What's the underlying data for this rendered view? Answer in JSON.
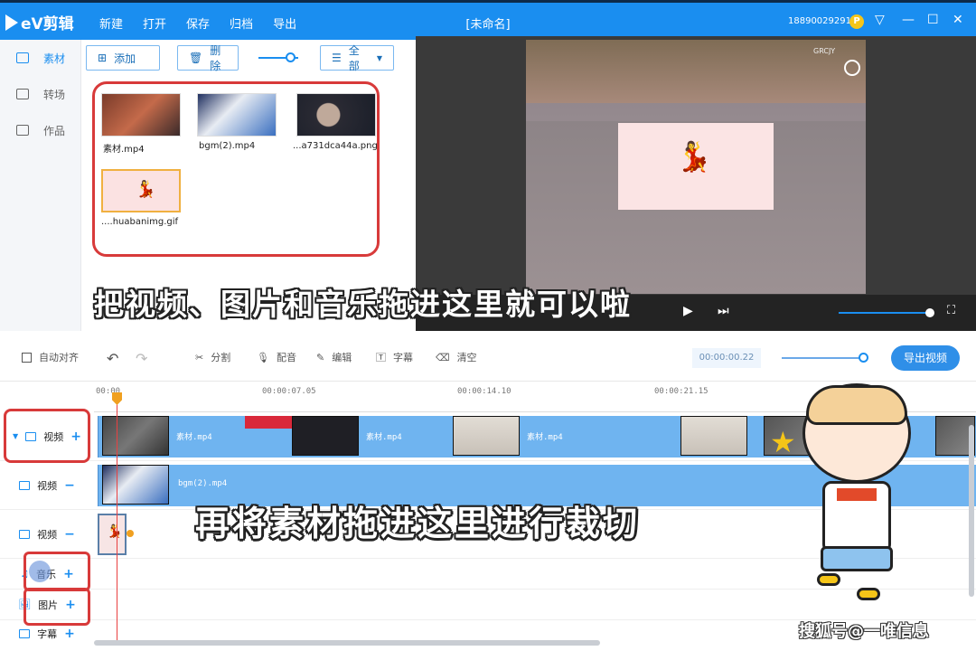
{
  "app": {
    "name": "eV剪辑",
    "window_title": "[未命名]",
    "phone": "18890029291",
    "coin": "P"
  },
  "menu": [
    "新建",
    "打开",
    "保存",
    "归档",
    "导出"
  ],
  "sidebar": {
    "items": [
      {
        "label": "素材",
        "active": true
      },
      {
        "label": "转场"
      },
      {
        "label": "作品"
      }
    ]
  },
  "library": {
    "add_label": "添加",
    "delete_label": "删除",
    "filter_label": "全部",
    "items": [
      {
        "name": "素材.mp4"
      },
      {
        "name": "bgm(2).mp4"
      },
      {
        "name": "...a731dca44a.png"
      },
      {
        "name": "....huabanimg.gif"
      }
    ]
  },
  "preview": {
    "video_watermark": "GRCJY"
  },
  "toolbar": {
    "auto_align": "自动对齐",
    "split": "分割",
    "dub": "配音",
    "edit": "编辑",
    "subtitle": "字幕",
    "clear": "清空",
    "timecode": "00:00:00.22",
    "export": "导出视频"
  },
  "timeline": {
    "ruler_ticks": [
      "00:00",
      "00:00:07.05",
      "00:00:14.10",
      "00:00:21.15"
    ],
    "tracks": [
      {
        "label": "视频",
        "pm": "+"
      },
      {
        "label": "视频",
        "pm": "−"
      },
      {
        "label": "视频",
        "pm": "−"
      },
      {
        "label": "音乐",
        "pm": "+"
      },
      {
        "label": "图片",
        "pm": "+"
      },
      {
        "label": "字幕",
        "pm": "+"
      }
    ],
    "clip_labels": [
      "素材.mp4",
      "素材.mp4",
      "素材.mp4"
    ],
    "bgm_label": "bgm(2).mp4"
  },
  "overlay": {
    "caption_top": "把视频、图片和音乐拖进这里就可以啦",
    "caption_bottom": "再将素材拖进这里进行裁切",
    "watermark": "搜狐号@一唯信息"
  },
  "colors": {
    "accent": "#1a8ef0",
    "annotation": "#d83a3a",
    "clip": "#6fb4f0"
  }
}
